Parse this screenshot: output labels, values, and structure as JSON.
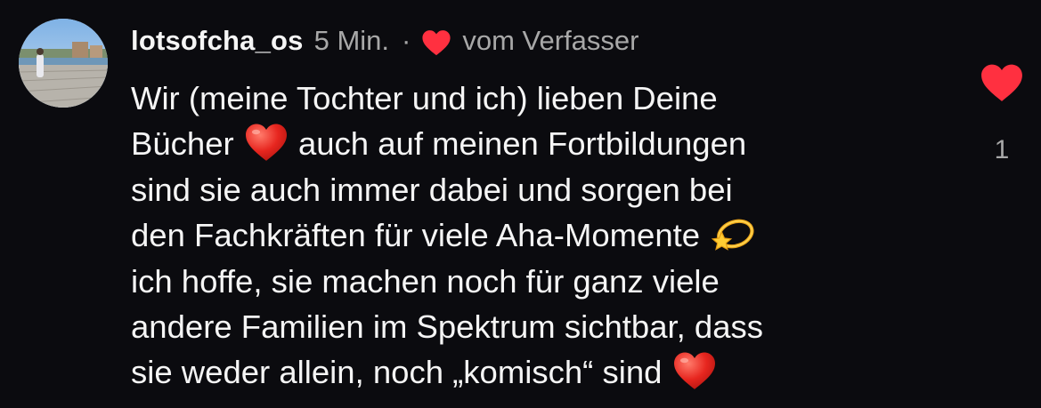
{
  "comment": {
    "username": "lotsofcha_os",
    "time": "5 Min.",
    "separator": "·",
    "by_author_label": "vom Verfasser",
    "text_lines": [
      "Wir (meine Tochter und ich) lieben Deine",
      "Bücher ",
      " auch auf meinen Fortbildungen",
      "sind sie auch immer dabei und sorgen bei",
      "den Fachkräften für viele Aha-Momente ",
      "ich hoffe, sie machen noch für ganz viele",
      "andere Familien im Spektrum sichtbar, dass",
      "sie weder allein, noch „komisch“ sind "
    ],
    "emojis": [
      "red-heart",
      "dizzy-star",
      "red-heart"
    ],
    "like_count": "1",
    "like_icon": "heart-icon",
    "colors": {
      "background": "#0b0b0f",
      "text": "#f5f5f5",
      "secondary_text": "#a8a8a8",
      "heart_red": "#ff3040"
    }
  }
}
